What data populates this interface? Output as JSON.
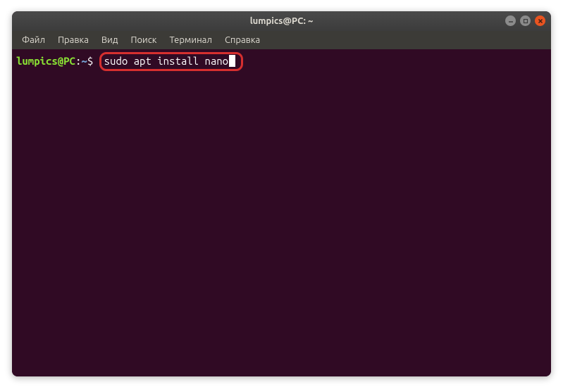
{
  "titlebar": {
    "title": "lumpics@PC: ~"
  },
  "menubar": {
    "items": [
      {
        "label": "Файл"
      },
      {
        "label": "Правка"
      },
      {
        "label": "Вид"
      },
      {
        "label": "Поиск"
      },
      {
        "label": "Терминал"
      },
      {
        "label": "Справка"
      }
    ]
  },
  "terminal": {
    "prompt_user": "lumpics@PC",
    "prompt_colon": ":",
    "prompt_path": "~",
    "prompt_dollar": "$ ",
    "command": "sudo apt install nano"
  }
}
